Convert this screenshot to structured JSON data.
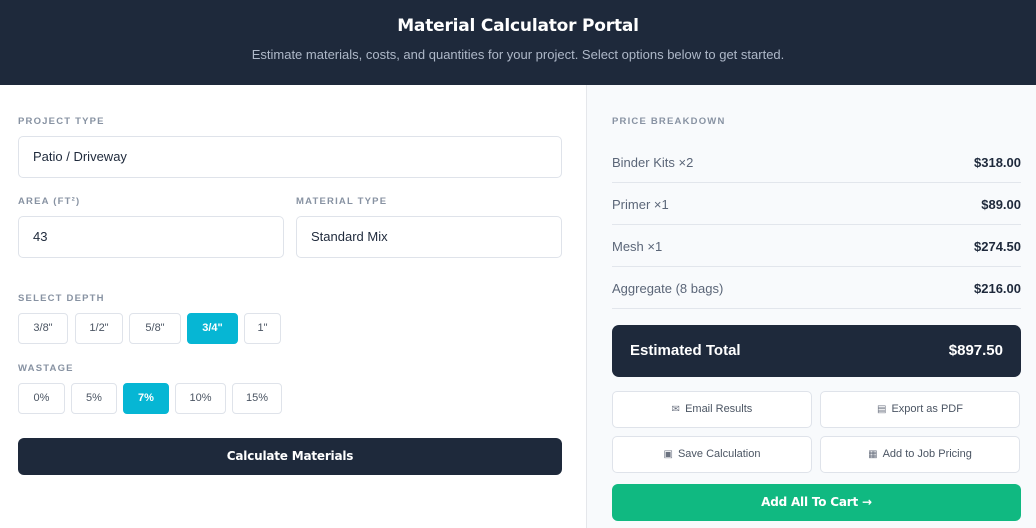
{
  "header": {
    "title": "Material Calculator Portal",
    "subtitle": "Estimate materials, costs, and quantities for your project. Select options below to get started."
  },
  "form": {
    "project_type_label": "PROJECT TYPE",
    "project_type_value": "Patio / Driveway",
    "area_label": "AREA (FT²)",
    "area_value": "43",
    "material_label": "MATERIAL TYPE",
    "material_value": "Standard Mix",
    "depth_label": "SELECT DEPTH",
    "depth_options": [
      "3/8\"",
      "1/2\"",
      "5/8\"",
      "3/4\"",
      "1\""
    ],
    "depth_selected": "3/4\"",
    "wastage_label": "WASTAGE",
    "wastage_options": [
      "0%",
      "5%",
      "7%",
      "10%",
      "15%"
    ],
    "wastage_selected": "7%",
    "calculate_label": "Calculate Materials"
  },
  "breakdown": {
    "label": "PRICE BREAKDOWN",
    "items": [
      {
        "name": "Binder Kits ×2",
        "price": "$318.00"
      },
      {
        "name": "Primer ×1",
        "price": "$89.00"
      },
      {
        "name": "Mesh ×1",
        "price": "$274.50"
      },
      {
        "name": "Aggregate (8 bags)",
        "price": "$216.00"
      }
    ],
    "total_label": "Estimated Total",
    "total_value": "$897.50"
  },
  "actions": {
    "email": "Email Results",
    "pdf": "Export as PDF",
    "save": "Save Calculation",
    "job": "Add to Job Pricing",
    "cart": "Add All To Cart →"
  },
  "colors": {
    "header_bg": "#1e293b",
    "accent": "#06b6d4",
    "cart_green": "#10b981"
  },
  "icons": {
    "email": "email-icon",
    "pdf": "document-icon",
    "save": "floppy-disk-icon",
    "job": "clipboard-icon"
  }
}
